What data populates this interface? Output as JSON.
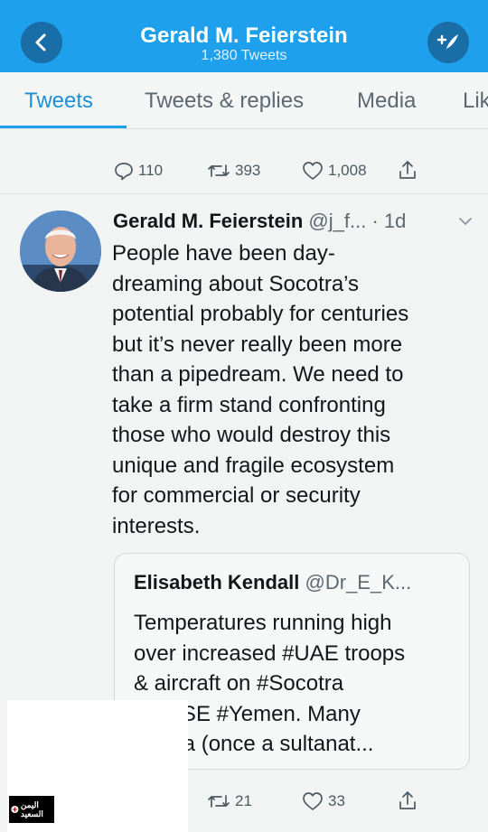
{
  "header": {
    "title": "Gerald M. Feierstein",
    "subtitle": "1,380 Tweets",
    "back_icon": "chevron-left-icon",
    "compose_icon": "compose-tweet-icon"
  },
  "tabs": [
    {
      "label": "Tweets",
      "active": true
    },
    {
      "label": "Tweets & replies",
      "active": false
    },
    {
      "label": "Media",
      "active": false
    },
    {
      "label": "Lik",
      "active": false
    }
  ],
  "prev_tweet_actions": {
    "replies": "110",
    "retweets": "393",
    "likes": "1,008"
  },
  "tweet": {
    "name": "Gerald M. Feierstein",
    "handle": "@j_f...",
    "time": "· 1d",
    "text": "People have been day-\ndreaming about Socotra’s\npotential probably for centuries\nbut it’s never really been more\nthan a pipedream. We need to\ntake a firm stand confronting\nthose who would destroy this\nunique and fragile ecosystem\nfor commercial or security\ninterests.",
    "quote": {
      "name": "Elisabeth Kendall",
      "handle": "@Dr_E_K...",
      "text": "Temperatures running high\nover increased #UAE troops\n& aircraft on #Socotra\n      d off SE #Yemen. Many\n      Mahra (once a sultanat..."
    },
    "actions": {
      "retweets": "21",
      "likes": "33"
    }
  },
  "watermark": {
    "text": "اليمن السعيد"
  },
  "colors": {
    "brand_blue": "#1ea0ec",
    "header_button": "#1a6ea8",
    "active_tab": "#1d8fd6"
  }
}
